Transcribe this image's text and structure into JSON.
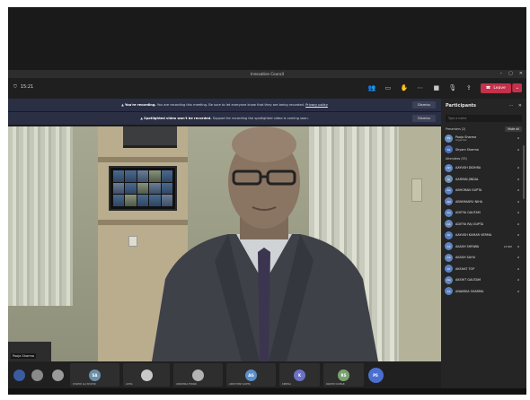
{
  "window": {
    "title": "Innovation Council"
  },
  "toolbar": {
    "timer": "15:21",
    "leave_label": "Leave",
    "icons": [
      "participants-icon",
      "chat-icon",
      "raise-hand-icon",
      "more-icon",
      "camera-icon",
      "mic-icon",
      "share-icon"
    ]
  },
  "banners": [
    {
      "strong": "You're recording.",
      "text": " You are recording this meeting. Be sure to let everyone know that they are being recorded.",
      "link": "Privacy policy",
      "dismiss": "Dismiss"
    },
    {
      "strong": "Spotlighted video won't be recorded.",
      "text": " Support for recording the spotlighted video is coming soon.",
      "link": "",
      "dismiss": "Dismiss"
    }
  ],
  "self_view": {
    "name": "Pooja Sharma"
  },
  "strip": [
    {
      "type": "avatar",
      "initials": "",
      "color": "#3a5ba0",
      "name": ""
    },
    {
      "type": "photo",
      "initials": "",
      "color": "#8a8a8a",
      "name": ""
    },
    {
      "type": "photo",
      "initials": "",
      "color": "#9a9a9a",
      "name": ""
    },
    {
      "type": "avatar",
      "initials": "SA",
      "color": "#6b8fa8",
      "name": "SHAHID ALI SHAHID"
    },
    {
      "type": "photo",
      "initials": "",
      "color": "#c9c9c9",
      "name": "ADHA"
    },
    {
      "type": "photo",
      "initials": "",
      "color": "#b3b3b3",
      "name": "VANSHIKA TIWARI"
    },
    {
      "type": "avatar",
      "initials": "AG",
      "color": "#5b8fc7",
      "name": "ASHUTOSH GUPTA"
    },
    {
      "type": "avatar",
      "initials": "K",
      "color": "#6a72c9",
      "name": "KIRTIKA"
    },
    {
      "type": "avatar",
      "initials": "RS",
      "color": "#7aa36e",
      "name": "RAKESH KUMAR"
    },
    {
      "type": "avatar",
      "initials": "PS",
      "color": "#4b6fd1",
      "name": ""
    }
  ],
  "panel": {
    "title": "Participants",
    "search_placeholder": "Type a name",
    "presenters_label": "Presenters (2)",
    "mute_all": "Mute all",
    "attendees_label": "Attendees (53)",
    "presenters": [
      {
        "name": "Pooja Sharma",
        "role": "Organizer",
        "initials": "PS",
        "color": "#6a8fc0"
      },
      {
        "name": "Shyam Sharma",
        "role": "",
        "initials": "SS",
        "color": "#4a70b8"
      }
    ],
    "attendees": [
      {
        "name": "AAYUSH DIDHRA",
        "initials": "AD",
        "color": "#5d86c4"
      },
      {
        "name": "AARYAN JINDAL",
        "initials": "AJ",
        "color": "#6f8fb0"
      },
      {
        "name": "ABHORAN GUPTA",
        "initials": "AG",
        "color": "#5b7fc0"
      },
      {
        "name": "ABHIMANYU NIHA",
        "initials": "AN",
        "color": "#647fb8"
      },
      {
        "name": "ADITYA GAUTAM",
        "initials": "AG",
        "color": "#5c83bf"
      },
      {
        "name": "ADITYA RAJ GUPTA",
        "initials": "AR",
        "color": "#6a86b2"
      },
      {
        "name": "AAYUSH KUMAR VERMA",
        "initials": "AK",
        "color": "#5a7dbc"
      },
      {
        "name": "AKASH SHRIWA",
        "initials": "AS",
        "color": "#5f84c1"
      },
      {
        "name": "AKASH SAHU",
        "initials": "AS",
        "color": "#6285bb"
      },
      {
        "name": "AKSHAT TOP",
        "initials": "AT",
        "color": "#5981c2"
      },
      {
        "name": "AKSHIT GAUTAM",
        "initials": "AG",
        "color": "#6384b9"
      },
      {
        "name": "ANAMIKA SHARMA",
        "initials": "AS",
        "color": "#5b80be"
      }
    ],
    "attendee_flag": "21 NIE"
  }
}
